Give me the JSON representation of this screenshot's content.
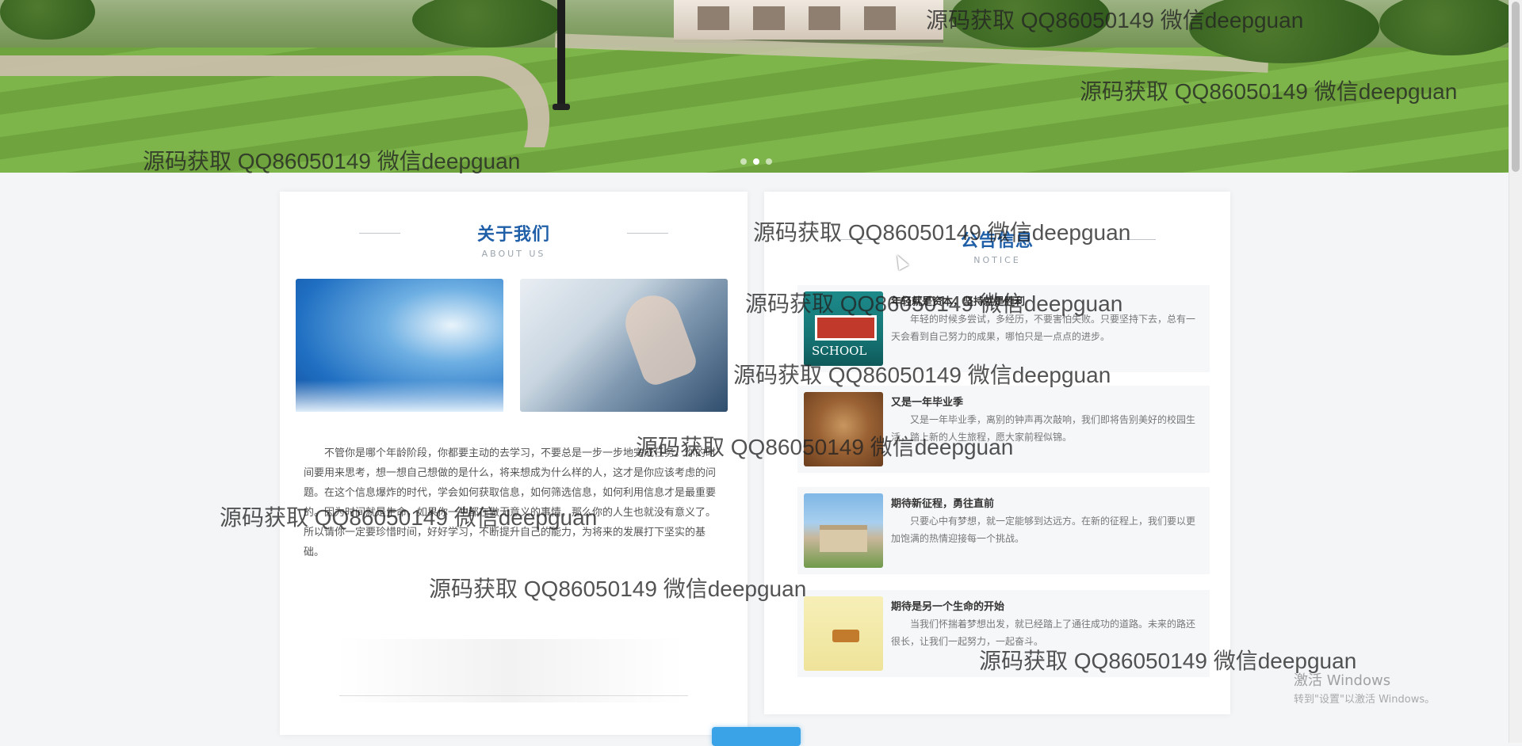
{
  "about": {
    "title": "关于我们",
    "subtitle": "ABOUT US",
    "text": "不管你是哪个年龄阶段，你都要主动的去学习，不要总是一步一步地完成任务。你的时间要用来思考，想一想自己想做的是什么，将来想成为什么样的人，这才是你应该考虑的问题。在这个信息爆炸的时代，学会如何获取信息，如何筛选信息，如何利用信息才是最重要的。因为时间就是生命，如果你一生都在做无意义的事情，那么你的人生也就没有意义了。所以请你一定要珍惜时间，好好学习，不断提升自己的能力，为将来的发展打下坚实的基础。"
  },
  "notice": {
    "title": "公告信息",
    "subtitle": "NOTICE",
    "items": [
      {
        "title": "年轻就是资本，坚持就是胜利",
        "desc": "年轻的时候多尝试，多经历，不要害怕失败。只要坚持下去，总有一天会看到自己努力的成果，哪怕只是一点点的进步。"
      },
      {
        "title": "又是一年毕业季",
        "desc": "又是一年毕业季，离别的钟声再次敲响，我们即将告别美好的校园生活，踏上新的人生旅程，愿大家前程似锦。"
      },
      {
        "title": "期待新征程，勇往直前",
        "desc": "只要心中有梦想，就一定能够到达远方。在新的征程上，我们要以更加饱满的热情迎接每一个挑战。"
      },
      {
        "title": "期待是另一个生命的开始",
        "desc": "当我们怀揣着梦想出发，就已经踏上了通往成功的道路。未来的路还很长，让我们一起努力，一起奋斗。"
      }
    ]
  },
  "more_button": "",
  "watermark": "源码获取 QQ86050149 微信deepguan",
  "windows_activation": {
    "line1": "激活 Windows",
    "line2": "转到\"设置\"以激活 Windows。"
  },
  "colors": {
    "accent": "#1f5fa8",
    "button": "#3aa2e6"
  }
}
